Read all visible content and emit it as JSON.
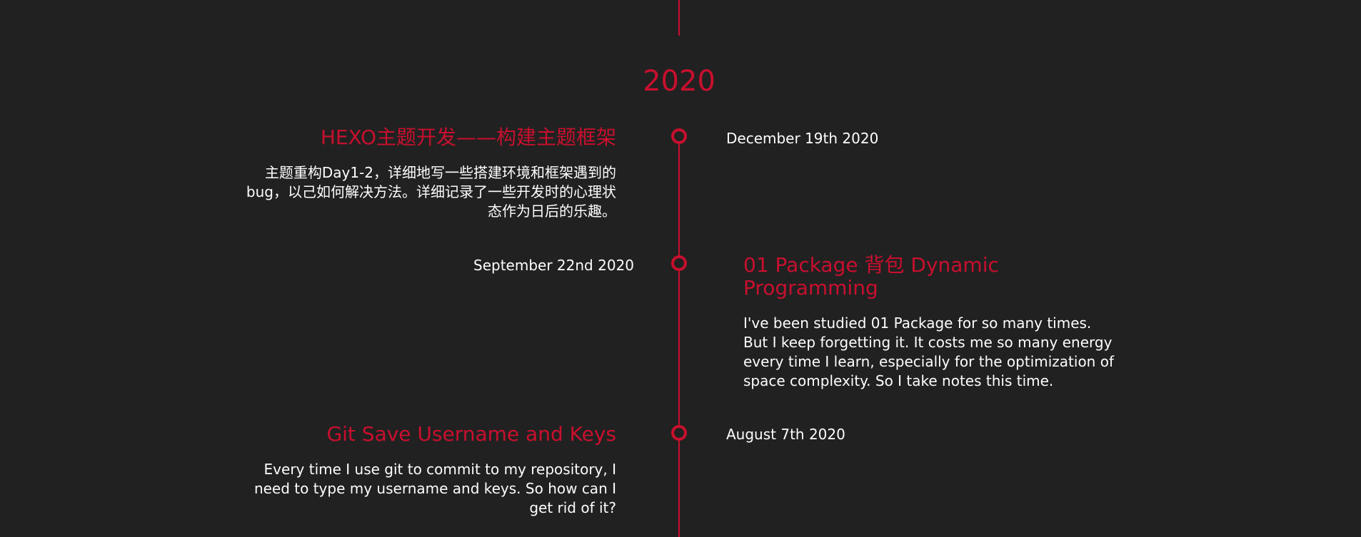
{
  "timeline": {
    "year": "2020",
    "posts": [
      {
        "title": "HEXO主题开发——构建主题框架",
        "description": "主题重构Day1-2，详细地写一些搭建环境和框架遇到的bug，以己如何解决方法。详细记录了一些开发时的心理状态作为日后的乐趣。",
        "date": "December 19th 2020"
      },
      {
        "title": "01 Package 背包 Dynamic Programming",
        "description": "I've been studied 01 Package for so many times. But I keep forgetting it. It costs me so many energy every time I learn, especially for the optimization of space complexity. So I take notes this time.",
        "date": "September 22nd 2020"
      },
      {
        "title": "Git Save Username and Keys",
        "description": "Every time I use git to commit to my repository, I need to type my username and keys. So how can I get rid of it?",
        "date": "August 7th 2020"
      }
    ]
  },
  "colors": {
    "accent": "#c8102e",
    "background": "#212121",
    "text": "#ffffff"
  }
}
